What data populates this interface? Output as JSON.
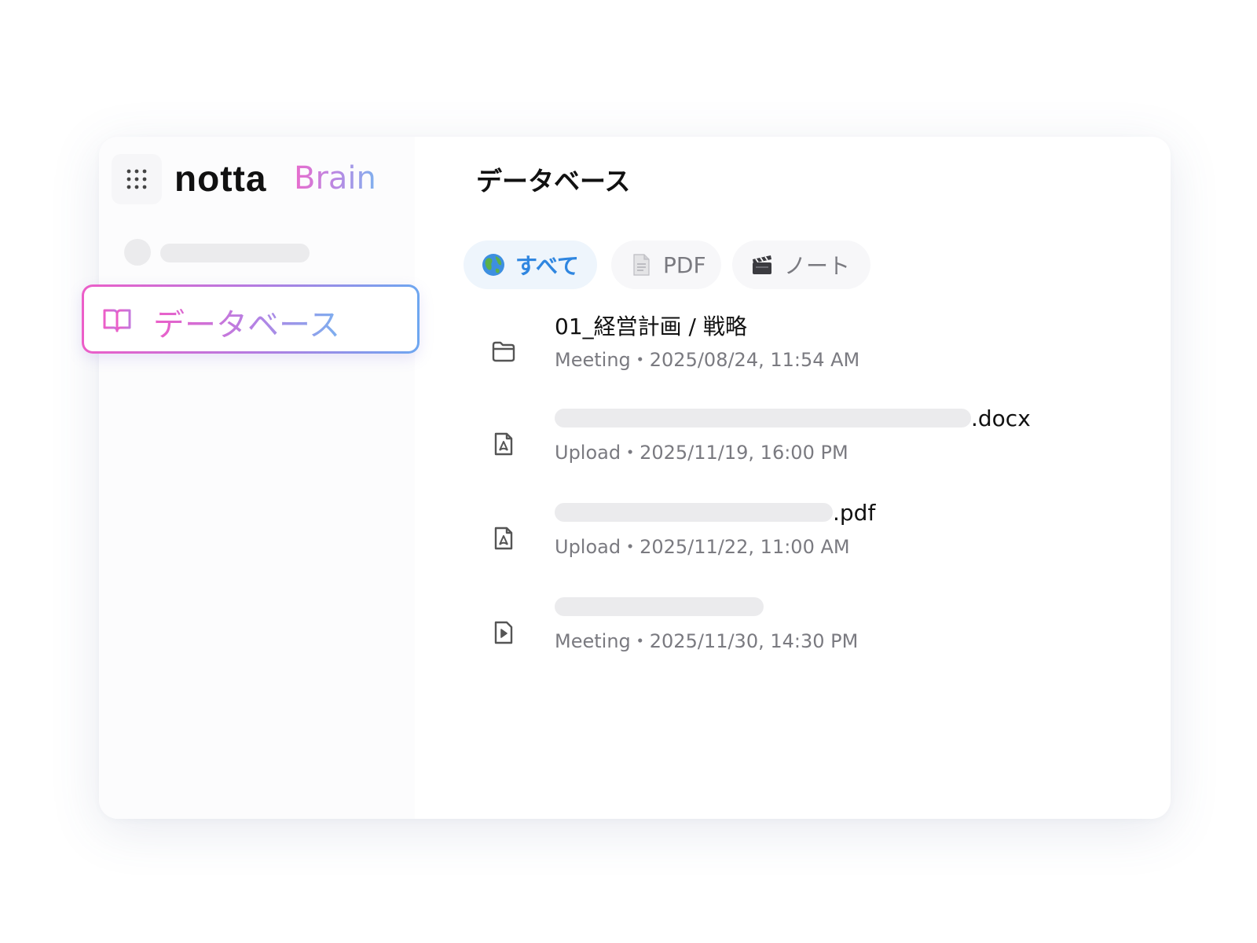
{
  "app": {
    "logo_primary": "notta",
    "logo_secondary": "Brain"
  },
  "sidebar": {
    "nav_item_label": "データベース"
  },
  "main": {
    "title": "データベース",
    "filters": [
      {
        "label": "すべて",
        "icon": "globe-icon",
        "active": true
      },
      {
        "label": "PDF",
        "icon": "document-icon",
        "active": false
      },
      {
        "label": "ノート",
        "icon": "clapper-icon",
        "active": false
      }
    ],
    "items": [
      {
        "title": "01_経営計画 / 戦略",
        "icon": "folder-icon",
        "meta": "Meeting・2025/08/24,  11:54 AM"
      },
      {
        "title_suffix": ".docx",
        "icon": "pdf-file-icon",
        "meta": "Upload・2025/11/19, 16:00 PM"
      },
      {
        "title_suffix": ".pdf",
        "icon": "pdf-file-icon",
        "meta": "Upload・2025/11/22, 11:00 AM"
      },
      {
        "title_suffix": "",
        "icon": "video-file-icon",
        "meta": "Meeting・2025/11/30, 14:30 PM"
      }
    ]
  },
  "colors": {
    "accent_blue": "#2f86e0",
    "gradient_pink": "#ec5ec8",
    "gradient_blue": "#6ea7f0"
  }
}
